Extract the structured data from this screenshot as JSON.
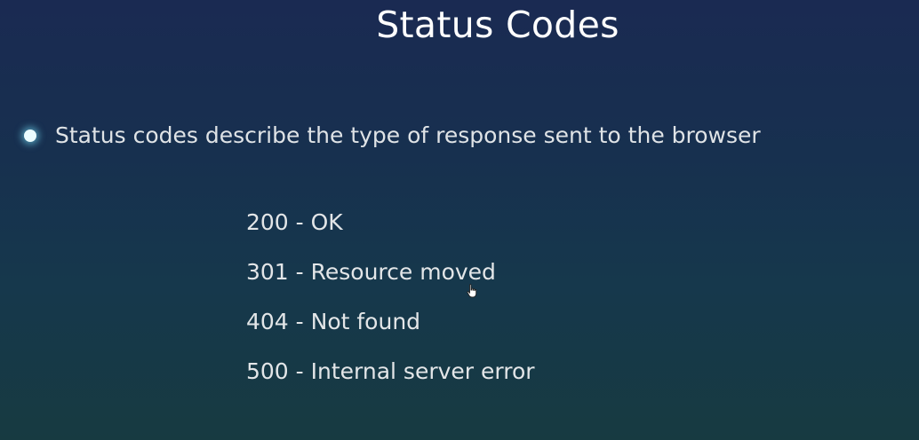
{
  "slide": {
    "title": "Status Codes",
    "bullet": "Status codes describe the type of response sent to the browser",
    "codes": [
      "200 - OK",
      "301 - Resource moved",
      "404 - Not found",
      "500 - Internal server error"
    ]
  },
  "colors": {
    "background_top": "#1a2a52",
    "background_bottom": "#173a41",
    "bullet_glow": "#78e6ff",
    "text": "#e3e6e8"
  },
  "icons": {
    "bullet": "glowing-dot-icon",
    "cursor": "hand-pointer-icon"
  }
}
